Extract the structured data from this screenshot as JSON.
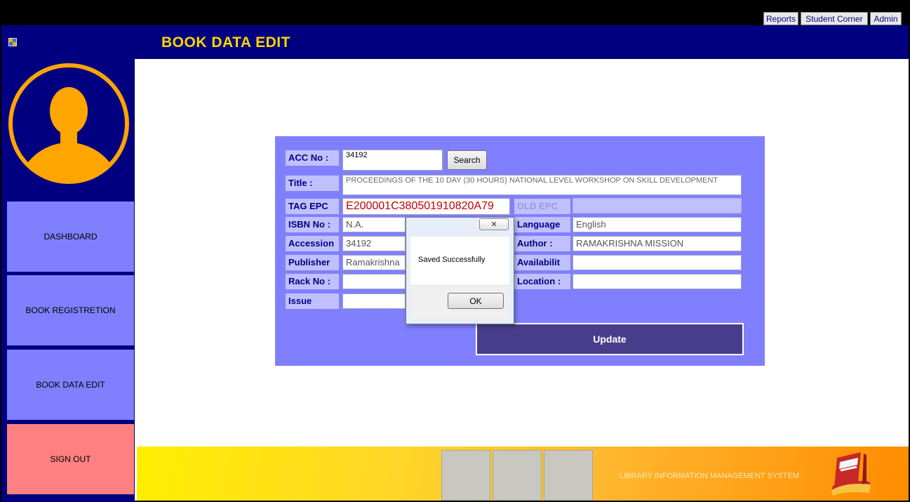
{
  "menu": {
    "reports": "Reports",
    "student_corner": "Student Corner",
    "admin": "Admin"
  },
  "header": {
    "title": "BOOK DATA EDIT"
  },
  "sidebar": {
    "items": [
      {
        "label": "DASHBOARD"
      },
      {
        "label": "BOOK REGISTRETION"
      },
      {
        "label": "BOOK DATA EDIT"
      },
      {
        "label": "SIGN OUT"
      }
    ]
  },
  "form": {
    "acc_no": {
      "label": "ACC No :",
      "value": "34192"
    },
    "search_label": "Search",
    "title": {
      "label": "Title :",
      "value": "PROCEEDINGS OF THE 10 DAY (30 HOURS) NATIONAL LEVEL WORKSHOP ON SKILL DEVELOPMENT"
    },
    "tag_epc": {
      "label": "TAG EPC",
      "value": "E200001C380501910820A79"
    },
    "old_epc": {
      "label": "OLD EPC",
      "value": ""
    },
    "isbn": {
      "label": "ISBN No :",
      "value": "N.A."
    },
    "language": {
      "label": "Language",
      "value": "English"
    },
    "accession": {
      "label": "Accession",
      "value": "34192"
    },
    "author": {
      "label": "Author :",
      "value": "RAMAKRISHNA MISSION"
    },
    "publisher": {
      "label": "Publisher",
      "value": "Ramakrishna"
    },
    "availability": {
      "label": "Availabilit",
      "value": ""
    },
    "rack_no": {
      "label": "Rack No :",
      "value": ""
    },
    "location": {
      "label": "Location :",
      "value": ""
    },
    "issue": {
      "label": "Issue",
      "value": ""
    },
    "update_label": "Update"
  },
  "dialog": {
    "close_glyph": "✕",
    "message": "Saved Successfully",
    "ok_label": "OK"
  },
  "footer": {
    "text": "LIBRARY INFORMATION MANAGEMENT SYSTEM"
  },
  "colors": {
    "navy": "#000080",
    "title_yellow": "#ffd700",
    "sidebar_button": "#8080ff",
    "sign_out": "#ff8080",
    "panel": "#8080ff",
    "update_button": "#483d8b",
    "tag_epc_text": "#c00000"
  }
}
